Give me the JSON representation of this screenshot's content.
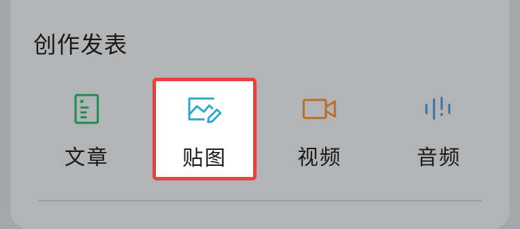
{
  "section": {
    "title": "创作发表"
  },
  "items": [
    {
      "label": "文章",
      "icon": "article-icon",
      "color": "#1f8a55"
    },
    {
      "label": "贴图",
      "icon": "image-icon",
      "color": "#2fa7c9",
      "highlighted": true
    },
    {
      "label": "视频",
      "icon": "video-camera-icon",
      "color": "#b86e2a"
    },
    {
      "label": "音频",
      "icon": "audio-wave-icon",
      "color": "#3a6fa8"
    }
  ],
  "colors": {
    "highlight_border": "#e8413f",
    "overlay_background": "#b3b4b6"
  }
}
